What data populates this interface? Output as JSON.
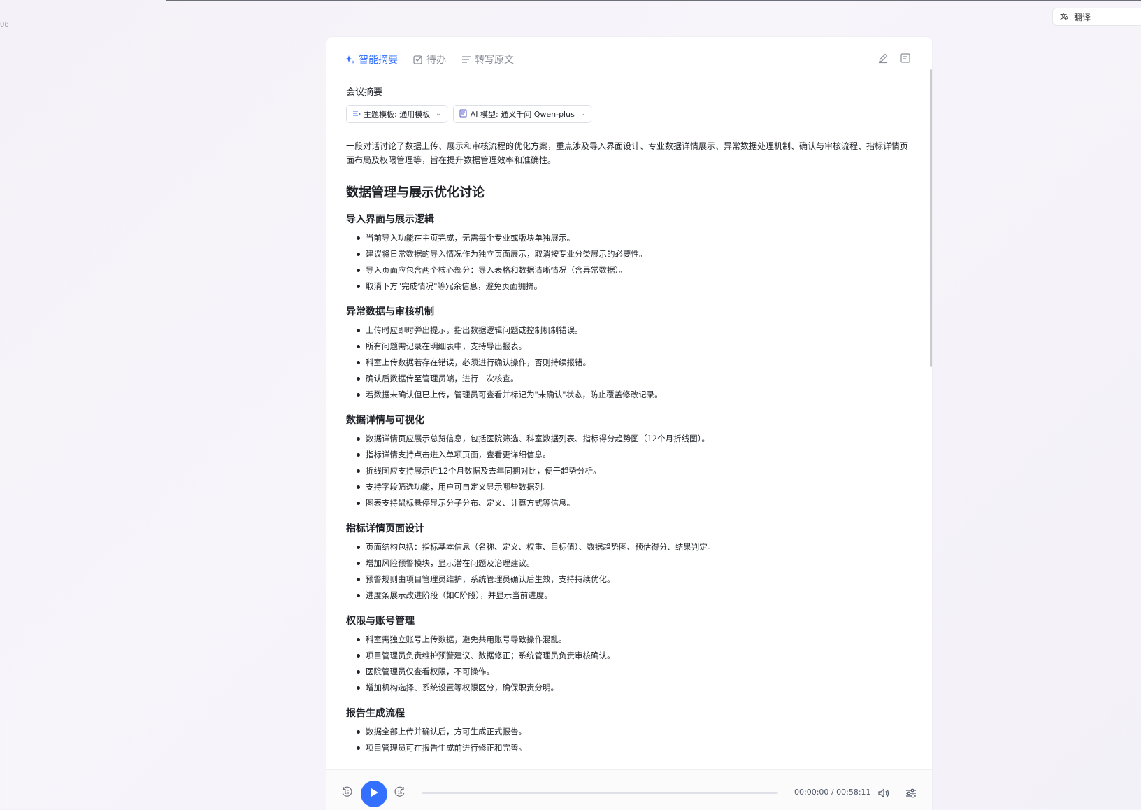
{
  "corner_text": "08",
  "translate_button": {
    "label": "翻译"
  },
  "tabs": [
    {
      "label": "智能摘要",
      "icon": "sparkle-icon",
      "active": true
    },
    {
      "label": "待办",
      "icon": "checkbox-icon",
      "active": false
    },
    {
      "label": "转写原文",
      "icon": "lines-icon",
      "active": false
    }
  ],
  "section_label": "会议摘要",
  "selectors": {
    "template": "主题模板: 通用模板",
    "model": "AI 模型: 通义千问 Qwen-plus"
  },
  "summary": "一段对话讨论了数据上传、展示和审核流程的优化方案，重点涉及导入界面设计、专业数据详情展示、异常数据处理机制、确认与审核流程、指标详情页面布局及权限管理等，旨在提升数据管理效率和准确性。",
  "main_title": "数据管理与展示优化讨论",
  "sections": [
    {
      "title": "导入界面与展示逻辑",
      "points": [
        "当前导入功能在主页完成，无需每个专业或版块单独展示。",
        "建议将日常数据的导入情况作为独立页面展示，取消按专业分类展示的必要性。",
        "导入页面应包含两个核心部分：导入表格和数据清晰情况（含异常数据）。",
        "取消下方\"完成情况\"等冗余信息，避免页面拥挤。"
      ]
    },
    {
      "title": "异常数据与审核机制",
      "points": [
        "上传时应即时弹出提示，指出数据逻辑问题或控制机制错误。",
        "所有问题需记录在明细表中，支持导出报表。",
        "科室上传数据若存在错误，必须进行确认操作，否则持续报错。",
        "确认后数据传至管理员端，进行二次核查。",
        "若数据未确认但已上传，管理员可查看并标记为\"未确认\"状态，防止覆盖修改记录。"
      ]
    },
    {
      "title": "数据详情与可视化",
      "points": [
        "数据详情页应展示总览信息，包括医院筛选、科室数据列表、指标得分趋势图（12个月折线图）。",
        "指标详情支持点击进入单项页面，查看更详细信息。",
        "折线图应支持展示近12个月数据及去年同期对比，便于趋势分析。",
        "支持字段筛选功能，用户可自定义显示哪些数据列。",
        "图表支持鼠标悬停显示分子分布、定义、计算方式等信息。"
      ]
    },
    {
      "title": "指标详情页面设计",
      "points": [
        "页面结构包括：指标基本信息（名称、定义、权重、目标值）、数据趋势图、预估得分、结果判定。",
        "增加风险预警模块，显示潜在问题及治理建议。",
        "预警规则由项目管理员维护，系统管理员确认后生效，支持持续优化。",
        "进度条展示改进阶段（如C阶段），并显示当前进度。"
      ]
    },
    {
      "title": "权限与账号管理",
      "points": [
        "科室需独立账号上传数据，避免共用账号导致操作混乱。",
        "项目管理员负责维护预警建议、数据修正；系统管理员负责审核确认。",
        "医院管理员仅查看权限，不可操作。",
        "增加机构选择、系统设置等权限区分，确保职责分明。"
      ]
    },
    {
      "title": "报告生成流程",
      "points": [
        "数据全部上传并确认后，方可生成正式报告。",
        "项目管理员可在报告生成前进行修正和完善。"
      ]
    }
  ],
  "player": {
    "current_time": "00:00:00",
    "separator": "/",
    "total_time": "00:58:11",
    "progress": 0,
    "skip_back_seconds": "15",
    "skip_forward_seconds": "15",
    "accent_color": "#3370ff"
  }
}
